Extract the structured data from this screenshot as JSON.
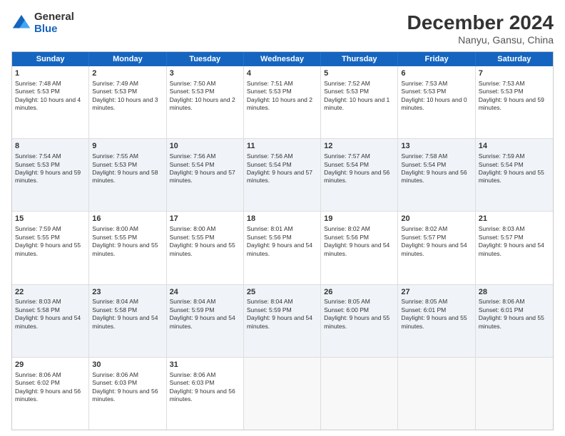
{
  "logo": {
    "general": "General",
    "blue": "Blue"
  },
  "header": {
    "month": "December 2024",
    "location": "Nanyu, Gansu, China"
  },
  "days": [
    "Sunday",
    "Monday",
    "Tuesday",
    "Wednesday",
    "Thursday",
    "Friday",
    "Saturday"
  ],
  "rows": [
    [
      {
        "day": "1",
        "rise": "7:48 AM",
        "set": "5:53 PM",
        "daylight": "10 hours and 4 minutes."
      },
      {
        "day": "2",
        "rise": "7:49 AM",
        "set": "5:53 PM",
        "daylight": "10 hours and 3 minutes."
      },
      {
        "day": "3",
        "rise": "7:50 AM",
        "set": "5:53 PM",
        "daylight": "10 hours and 2 minutes."
      },
      {
        "day": "4",
        "rise": "7:51 AM",
        "set": "5:53 PM",
        "daylight": "10 hours and 2 minutes."
      },
      {
        "day": "5",
        "rise": "7:52 AM",
        "set": "5:53 PM",
        "daylight": "10 hours and 1 minute."
      },
      {
        "day": "6",
        "rise": "7:53 AM",
        "set": "5:53 PM",
        "daylight": "10 hours and 0 minutes."
      },
      {
        "day": "7",
        "rise": "7:53 AM",
        "set": "5:53 PM",
        "daylight": "9 hours and 59 minutes."
      }
    ],
    [
      {
        "day": "8",
        "rise": "7:54 AM",
        "set": "5:53 PM",
        "daylight": "9 hours and 59 minutes."
      },
      {
        "day": "9",
        "rise": "7:55 AM",
        "set": "5:53 PM",
        "daylight": "9 hours and 58 minutes."
      },
      {
        "day": "10",
        "rise": "7:56 AM",
        "set": "5:54 PM",
        "daylight": "9 hours and 57 minutes."
      },
      {
        "day": "11",
        "rise": "7:56 AM",
        "set": "5:54 PM",
        "daylight": "9 hours and 57 minutes."
      },
      {
        "day": "12",
        "rise": "7:57 AM",
        "set": "5:54 PM",
        "daylight": "9 hours and 56 minutes."
      },
      {
        "day": "13",
        "rise": "7:58 AM",
        "set": "5:54 PM",
        "daylight": "9 hours and 56 minutes."
      },
      {
        "day": "14",
        "rise": "7:59 AM",
        "set": "5:54 PM",
        "daylight": "9 hours and 55 minutes."
      }
    ],
    [
      {
        "day": "15",
        "rise": "7:59 AM",
        "set": "5:55 PM",
        "daylight": "9 hours and 55 minutes."
      },
      {
        "day": "16",
        "rise": "8:00 AM",
        "set": "5:55 PM",
        "daylight": "9 hours and 55 minutes."
      },
      {
        "day": "17",
        "rise": "8:00 AM",
        "set": "5:55 PM",
        "daylight": "9 hours and 55 minutes."
      },
      {
        "day": "18",
        "rise": "8:01 AM",
        "set": "5:56 PM",
        "daylight": "9 hours and 54 minutes."
      },
      {
        "day": "19",
        "rise": "8:02 AM",
        "set": "5:56 PM",
        "daylight": "9 hours and 54 minutes."
      },
      {
        "day": "20",
        "rise": "8:02 AM",
        "set": "5:57 PM",
        "daylight": "9 hours and 54 minutes."
      },
      {
        "day": "21",
        "rise": "8:03 AM",
        "set": "5:57 PM",
        "daylight": "9 hours and 54 minutes."
      }
    ],
    [
      {
        "day": "22",
        "rise": "8:03 AM",
        "set": "5:58 PM",
        "daylight": "9 hours and 54 minutes."
      },
      {
        "day": "23",
        "rise": "8:04 AM",
        "set": "5:58 PM",
        "daylight": "9 hours and 54 minutes."
      },
      {
        "day": "24",
        "rise": "8:04 AM",
        "set": "5:59 PM",
        "daylight": "9 hours and 54 minutes."
      },
      {
        "day": "25",
        "rise": "8:04 AM",
        "set": "5:59 PM",
        "daylight": "9 hours and 54 minutes."
      },
      {
        "day": "26",
        "rise": "8:05 AM",
        "set": "6:00 PM",
        "daylight": "9 hours and 55 minutes."
      },
      {
        "day": "27",
        "rise": "8:05 AM",
        "set": "6:01 PM",
        "daylight": "9 hours and 55 minutes."
      },
      {
        "day": "28",
        "rise": "8:06 AM",
        "set": "6:01 PM",
        "daylight": "9 hours and 55 minutes."
      }
    ],
    [
      {
        "day": "29",
        "rise": "8:06 AM",
        "set": "6:02 PM",
        "daylight": "9 hours and 56 minutes."
      },
      {
        "day": "30",
        "rise": "8:06 AM",
        "set": "6:03 PM",
        "daylight": "9 hours and 56 minutes."
      },
      {
        "day": "31",
        "rise": "8:06 AM",
        "set": "6:03 PM",
        "daylight": "9 hours and 56 minutes."
      },
      null,
      null,
      null,
      null
    ]
  ],
  "alt_rows": [
    false,
    true,
    false,
    true,
    false
  ]
}
